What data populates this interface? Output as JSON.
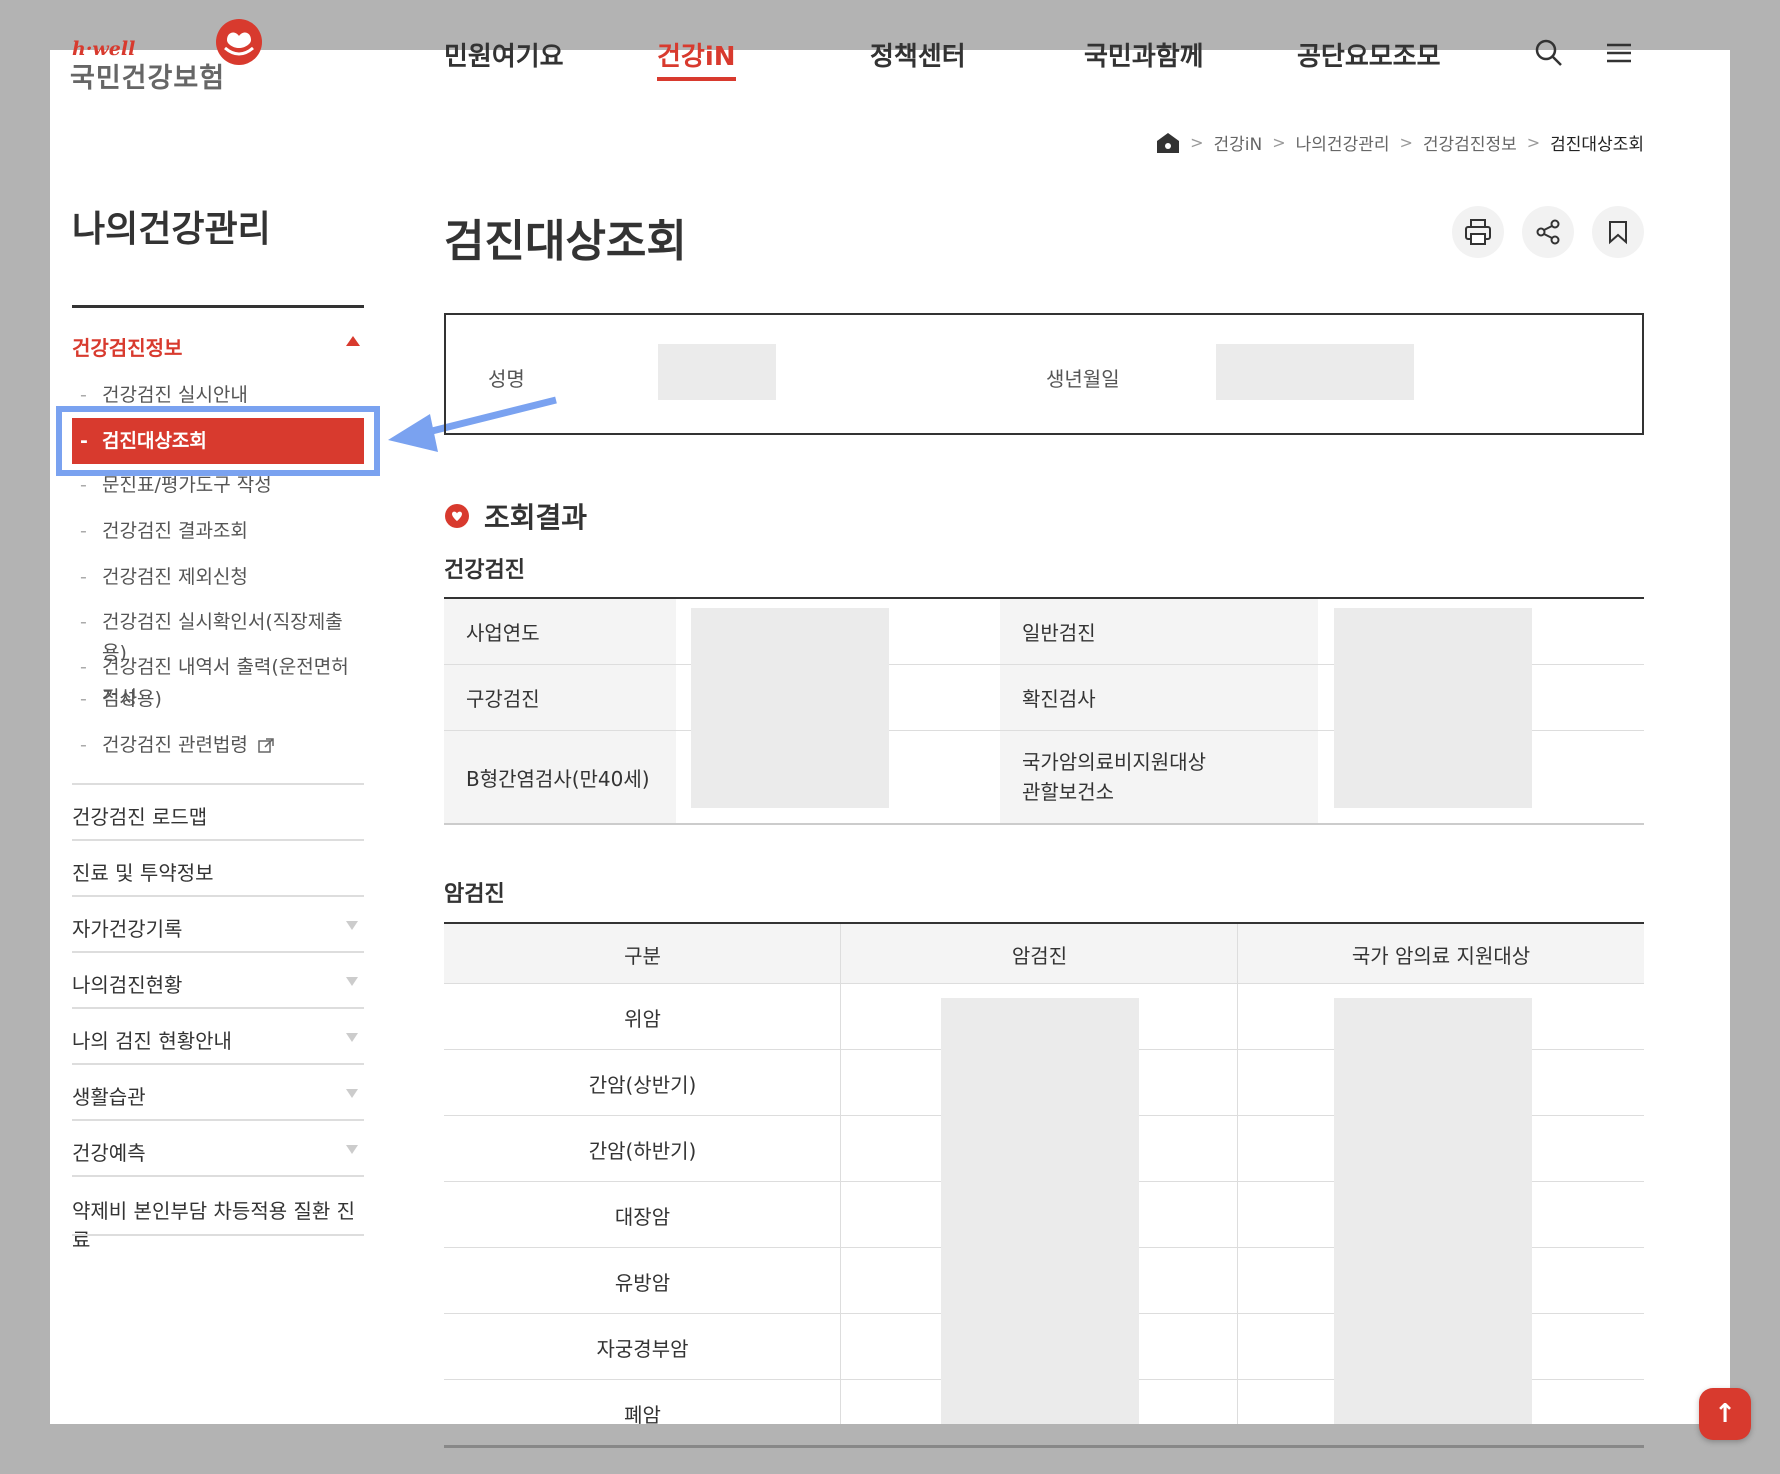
{
  "logo": {
    "sub": "h·well",
    "name": "국민건강보험"
  },
  "gnb": [
    "민원여기요",
    "건강iN",
    "정책센터",
    "국민과함께",
    "공단요모조모"
  ],
  "breadcrumb": [
    "건강iN",
    "나의건강관리",
    "건강검진정보",
    "검진대상조회"
  ],
  "sidebar": {
    "title": "나의건강관리",
    "group": "건강검진정보",
    "sub_items": [
      "건강검진 실시안내",
      "검진대상조회",
      "문진표/평가도구 작성",
      "건강검진 결과조회",
      "건강검진 제외신청",
      "건강검진 실시확인서(직장제출용)",
      "건강검진 내역서 출력(운전면허적성",
      "검사용)",
      "건강검진 관련법령"
    ],
    "items": [
      "건강검진 로드맵",
      "진료 및 투약정보",
      "자가건강기록",
      "나의검진현황",
      "나의 검진 현황안내",
      "생활습관",
      "건강예측",
      "약제비 본인부담 차등적용 질환 진료"
    ]
  },
  "main": {
    "title": "검진대상조회",
    "info": {
      "name_label": "성명",
      "birth_label": "생년월일"
    },
    "result_title": "조회결과",
    "health_check": {
      "title": "건강검진",
      "rows": [
        [
          "사업연도",
          "일반검진"
        ],
        [
          "구강검진",
          "확진검사"
        ],
        [
          "B형간염검사(만40세)",
          "국가암의료비지원대상",
          "관할보건소"
        ]
      ]
    },
    "cancer": {
      "title": "암검진",
      "headers": [
        "구분",
        "암검진",
        "국가 암의료 지원대상"
      ],
      "rows": [
        "위암",
        "간암(상반기)",
        "간암(하반기)",
        "대장암",
        "유방암",
        "자궁경부암",
        "폐암"
      ]
    }
  },
  "colors": {
    "brand": "#d83a2e",
    "highlight": "#7aa2f0"
  },
  "icons": [
    "search-icon",
    "menu-icon",
    "home-icon",
    "print-icon",
    "share-icon",
    "bookmark-icon",
    "external-link-icon",
    "heart-icon",
    "arrow-up-icon"
  ]
}
